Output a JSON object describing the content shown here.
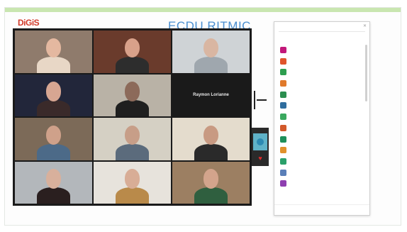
{
  "slide": {
    "logo": "DiGiS",
    "title": "ECDU RITMIC"
  },
  "gallery": {
    "tiles": [
      {
        "name": "",
        "bg": "#8f7b6c",
        "skin": "#e4b8a0",
        "shirt": "#e8d7c6"
      },
      {
        "name": "",
        "bg": "#6a3b2c",
        "skin": "#d8a18a",
        "shirt": "#2d2d2d"
      },
      {
        "name": "",
        "bg": "#cfd3d6",
        "skin": "#d9b6a2",
        "shirt": "#9fa7ae"
      },
      {
        "name": "",
        "bg": "#22263a",
        "skin": "#d7a692",
        "shirt": "#3a2a2a"
      },
      {
        "name": "",
        "bg": "#b9b2a6",
        "skin": "#8c6a5a",
        "shirt": "#1f1f1f"
      },
      {
        "name": "Raymon Lorianne",
        "bg": "#1a1a1a",
        "blank": true
      },
      {
        "name": "",
        "bg": "#7c6a58",
        "skin": "#cfa18a",
        "shirt": "#4c6a88"
      },
      {
        "name": "",
        "bg": "#d5d0c4",
        "skin": "#c79e88",
        "shirt": "#5b6b7c"
      },
      {
        "name": "",
        "bg": "#e4dccd",
        "skin": "#c89a82",
        "shirt": "#2a2a2a"
      },
      {
        "name": "",
        "bg": "#b3b7bb",
        "skin": "#d8b09c",
        "shirt": "#2a1f1f"
      },
      {
        "name": "",
        "bg": "#e7e3dc",
        "skin": "#d8ad96",
        "shirt": "#b98a4a"
      },
      {
        "name": "",
        "bg": "#9c7f62",
        "skin": "#d3a48c",
        "shirt": "#2f5f3f"
      }
    ]
  },
  "panel": {
    "title": "",
    "header": "",
    "participants": [
      {
        "color": "#c2187a",
        "name": "",
        "info": ""
      },
      {
        "color": "#e0542b",
        "name": "",
        "info": ""
      },
      {
        "color": "#2e9e4f",
        "name": "",
        "info": ""
      },
      {
        "color": "#e07a2b",
        "name": "",
        "info": ""
      },
      {
        "color": "#2b8e4f",
        "name": "",
        "info": ""
      },
      {
        "color": "#2f6d9e",
        "name": "",
        "info": ""
      },
      {
        "color": "#3aa85e",
        "name": "",
        "info": ""
      },
      {
        "color": "#d2592a",
        "name": "",
        "info": ""
      },
      {
        "color": "#1e8f5a",
        "name": "",
        "info": ""
      },
      {
        "color": "#e0912b",
        "name": "",
        "info": ""
      },
      {
        "color": "#2aa06a",
        "name": "",
        "info": ""
      },
      {
        "color": "#5a7fb8",
        "name": "",
        "info": ""
      },
      {
        "color": "#8e3fb0",
        "name": "",
        "info": ""
      }
    ],
    "footer": {
      "left": "",
      "middle": "",
      "right": ""
    }
  }
}
